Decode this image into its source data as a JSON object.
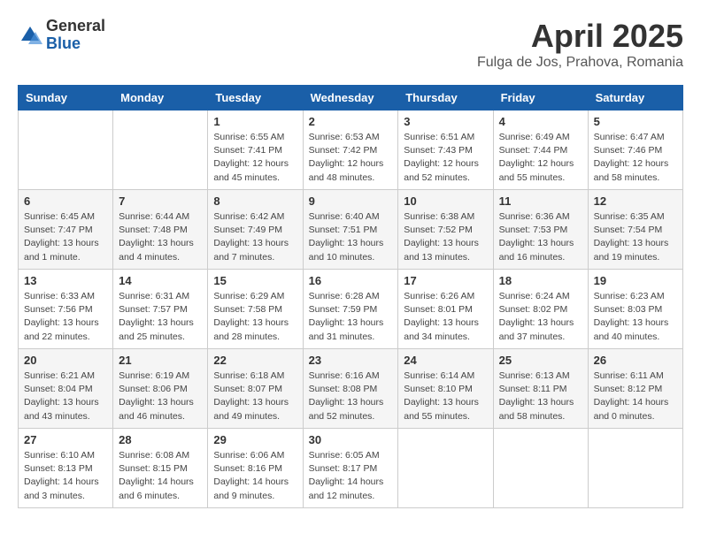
{
  "header": {
    "logo_general": "General",
    "logo_blue": "Blue",
    "title": "April 2025",
    "location": "Fulga de Jos, Prahova, Romania"
  },
  "weekdays": [
    "Sunday",
    "Monday",
    "Tuesday",
    "Wednesday",
    "Thursday",
    "Friday",
    "Saturday"
  ],
  "weeks": [
    [
      {
        "day": "",
        "detail": ""
      },
      {
        "day": "",
        "detail": ""
      },
      {
        "day": "1",
        "detail": "Sunrise: 6:55 AM\nSunset: 7:41 PM\nDaylight: 12 hours\nand 45 minutes."
      },
      {
        "day": "2",
        "detail": "Sunrise: 6:53 AM\nSunset: 7:42 PM\nDaylight: 12 hours\nand 48 minutes."
      },
      {
        "day": "3",
        "detail": "Sunrise: 6:51 AM\nSunset: 7:43 PM\nDaylight: 12 hours\nand 52 minutes."
      },
      {
        "day": "4",
        "detail": "Sunrise: 6:49 AM\nSunset: 7:44 PM\nDaylight: 12 hours\nand 55 minutes."
      },
      {
        "day": "5",
        "detail": "Sunrise: 6:47 AM\nSunset: 7:46 PM\nDaylight: 12 hours\nand 58 minutes."
      }
    ],
    [
      {
        "day": "6",
        "detail": "Sunrise: 6:45 AM\nSunset: 7:47 PM\nDaylight: 13 hours\nand 1 minute."
      },
      {
        "day": "7",
        "detail": "Sunrise: 6:44 AM\nSunset: 7:48 PM\nDaylight: 13 hours\nand 4 minutes."
      },
      {
        "day": "8",
        "detail": "Sunrise: 6:42 AM\nSunset: 7:49 PM\nDaylight: 13 hours\nand 7 minutes."
      },
      {
        "day": "9",
        "detail": "Sunrise: 6:40 AM\nSunset: 7:51 PM\nDaylight: 13 hours\nand 10 minutes."
      },
      {
        "day": "10",
        "detail": "Sunrise: 6:38 AM\nSunset: 7:52 PM\nDaylight: 13 hours\nand 13 minutes."
      },
      {
        "day": "11",
        "detail": "Sunrise: 6:36 AM\nSunset: 7:53 PM\nDaylight: 13 hours\nand 16 minutes."
      },
      {
        "day": "12",
        "detail": "Sunrise: 6:35 AM\nSunset: 7:54 PM\nDaylight: 13 hours\nand 19 minutes."
      }
    ],
    [
      {
        "day": "13",
        "detail": "Sunrise: 6:33 AM\nSunset: 7:56 PM\nDaylight: 13 hours\nand 22 minutes."
      },
      {
        "day": "14",
        "detail": "Sunrise: 6:31 AM\nSunset: 7:57 PM\nDaylight: 13 hours\nand 25 minutes."
      },
      {
        "day": "15",
        "detail": "Sunrise: 6:29 AM\nSunset: 7:58 PM\nDaylight: 13 hours\nand 28 minutes."
      },
      {
        "day": "16",
        "detail": "Sunrise: 6:28 AM\nSunset: 7:59 PM\nDaylight: 13 hours\nand 31 minutes."
      },
      {
        "day": "17",
        "detail": "Sunrise: 6:26 AM\nSunset: 8:01 PM\nDaylight: 13 hours\nand 34 minutes."
      },
      {
        "day": "18",
        "detail": "Sunrise: 6:24 AM\nSunset: 8:02 PM\nDaylight: 13 hours\nand 37 minutes."
      },
      {
        "day": "19",
        "detail": "Sunrise: 6:23 AM\nSunset: 8:03 PM\nDaylight: 13 hours\nand 40 minutes."
      }
    ],
    [
      {
        "day": "20",
        "detail": "Sunrise: 6:21 AM\nSunset: 8:04 PM\nDaylight: 13 hours\nand 43 minutes."
      },
      {
        "day": "21",
        "detail": "Sunrise: 6:19 AM\nSunset: 8:06 PM\nDaylight: 13 hours\nand 46 minutes."
      },
      {
        "day": "22",
        "detail": "Sunrise: 6:18 AM\nSunset: 8:07 PM\nDaylight: 13 hours\nand 49 minutes."
      },
      {
        "day": "23",
        "detail": "Sunrise: 6:16 AM\nSunset: 8:08 PM\nDaylight: 13 hours\nand 52 minutes."
      },
      {
        "day": "24",
        "detail": "Sunrise: 6:14 AM\nSunset: 8:10 PM\nDaylight: 13 hours\nand 55 minutes."
      },
      {
        "day": "25",
        "detail": "Sunrise: 6:13 AM\nSunset: 8:11 PM\nDaylight: 13 hours\nand 58 minutes."
      },
      {
        "day": "26",
        "detail": "Sunrise: 6:11 AM\nSunset: 8:12 PM\nDaylight: 14 hours\nand 0 minutes."
      }
    ],
    [
      {
        "day": "27",
        "detail": "Sunrise: 6:10 AM\nSunset: 8:13 PM\nDaylight: 14 hours\nand 3 minutes."
      },
      {
        "day": "28",
        "detail": "Sunrise: 6:08 AM\nSunset: 8:15 PM\nDaylight: 14 hours\nand 6 minutes."
      },
      {
        "day": "29",
        "detail": "Sunrise: 6:06 AM\nSunset: 8:16 PM\nDaylight: 14 hours\nand 9 minutes."
      },
      {
        "day": "30",
        "detail": "Sunrise: 6:05 AM\nSunset: 8:17 PM\nDaylight: 14 hours\nand 12 minutes."
      },
      {
        "day": "",
        "detail": ""
      },
      {
        "day": "",
        "detail": ""
      },
      {
        "day": "",
        "detail": ""
      }
    ]
  ]
}
